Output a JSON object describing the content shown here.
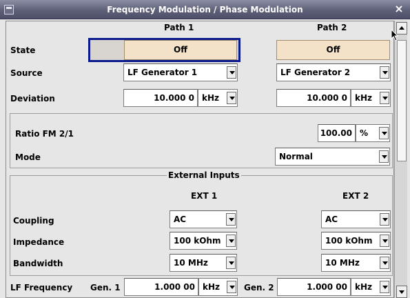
{
  "window": {
    "title": "Frequency Modulation / Phase Modulation",
    "close_glyph": "×"
  },
  "columns": {
    "path1": "Path 1",
    "path2": "Path 2"
  },
  "rows": {
    "state": {
      "label": "State",
      "path1": "Off",
      "path2": "Off"
    },
    "source": {
      "label": "Source",
      "path1": "LF Generator 1",
      "path2": "LF Generator 2"
    },
    "deviation": {
      "label": "Deviation",
      "path1_value": "10.000 0",
      "path1_unit": "kHz",
      "path2_value": "10.000 0",
      "path2_unit": "kHz"
    }
  },
  "ratio": {
    "label": "Ratio FM 2/1",
    "value": "100.00",
    "unit": "%"
  },
  "mode": {
    "label": "Mode",
    "value": "Normal"
  },
  "external_inputs": {
    "title": "External Inputs",
    "ext1": "EXT 1",
    "ext2": "EXT 2",
    "coupling": {
      "label": "Coupling",
      "ext1": "AC",
      "ext2": "AC"
    },
    "impedance": {
      "label": "Impedance",
      "ext1": "100 kOhm",
      "ext2": "100 kOhm"
    },
    "bandwidth": {
      "label": "Bandwidth",
      "ext1": "10 MHz",
      "ext2": "10 MHz"
    }
  },
  "lf_frequency": {
    "label": "LF Frequency",
    "gen1_label": "Gen. 1",
    "gen1_value": "1.000 00",
    "gen1_unit": "kHz",
    "gen2_label": "Gen. 2",
    "gen2_value": "1.000 00",
    "gen2_unit": "kHz"
  },
  "icons": [
    "window-menu-icon",
    "close-icon",
    "dropdown-arrow-icon",
    "scroll-up-icon",
    "scroll-down-icon",
    "mouse-cursor-icon"
  ],
  "colors": {
    "titlebar": "#5e6078",
    "button_off": "#f3e2c8",
    "focus_border": "#0a1a8c"
  }
}
